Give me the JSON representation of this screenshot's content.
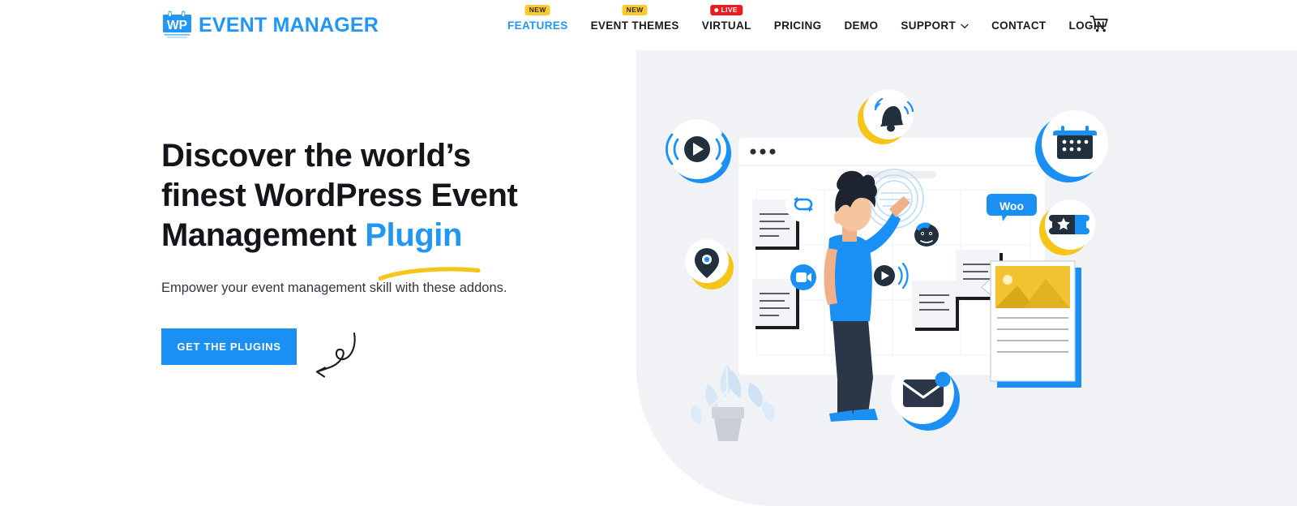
{
  "brand": {
    "logo_icon": "calendar-wp-icon",
    "logo_mark_text": "WP",
    "name": "EVENT MANAGER",
    "color": "#2196f3"
  },
  "nav": {
    "items": [
      {
        "label": "FEATURES",
        "active": true,
        "badge": "NEW",
        "badge_type": "new",
        "has_chevron": false
      },
      {
        "label": "EVENT THEMES",
        "active": false,
        "badge": "NEW",
        "badge_type": "new",
        "has_chevron": false
      },
      {
        "label": "VIRTUAL",
        "active": false,
        "badge": "LIVE",
        "badge_type": "live",
        "has_chevron": false
      },
      {
        "label": "PRICING",
        "active": false,
        "badge": "",
        "badge_type": "",
        "has_chevron": false
      },
      {
        "label": "DEMO",
        "active": false,
        "badge": "",
        "badge_type": "",
        "has_chevron": false
      },
      {
        "label": "SUPPORT",
        "active": false,
        "badge": "",
        "badge_type": "",
        "has_chevron": true
      },
      {
        "label": "CONTACT",
        "active": false,
        "badge": "",
        "badge_type": "",
        "has_chevron": false
      },
      {
        "label": "LOGIN",
        "active": false,
        "badge": "",
        "badge_type": "",
        "has_chevron": false
      }
    ],
    "cart_icon": "shopping-cart-icon",
    "badge_new_color": "#ffc82c",
    "badge_live_color": "#e81d1d"
  },
  "hero": {
    "headline_line1": "Discover the world’s",
    "headline_line2": "finest WordPress Event",
    "headline_line3_plain": "Management ",
    "headline_accent": "Plugin",
    "subtitle": "Empower your event management skill with these addons.",
    "cta_label": "GET THE PLUGINS",
    "cta_color": "#1a90f5",
    "accent_color": "#2196f3",
    "underline_color": "#f5c518",
    "panel_bg": "#f1f2f6"
  },
  "illustration": {
    "floating_icons": [
      {
        "name": "broadcast-play-icon",
        "ring": "#1a90f5"
      },
      {
        "name": "bell-notification-icon",
        "ring": "#f5c518"
      },
      {
        "name": "calendar-icon",
        "ring": "#1a90f5"
      },
      {
        "name": "location-pin-icon",
        "ring": "#f5c518"
      },
      {
        "name": "ticket-star-icon",
        "ring": "#f5c518"
      },
      {
        "name": "email-envelope-icon",
        "ring": "#1a90f5"
      }
    ],
    "inline_icons": [
      {
        "name": "sync-refresh-icon"
      },
      {
        "name": "video-camera-icon"
      },
      {
        "name": "small-play-icon"
      },
      {
        "name": "mailchimp-icon"
      },
      {
        "name": "woocommerce-icon",
        "text": "Woo"
      }
    ],
    "browser_dots": 3,
    "person": "woman-standing-at-board",
    "plant": "potted-plant"
  }
}
